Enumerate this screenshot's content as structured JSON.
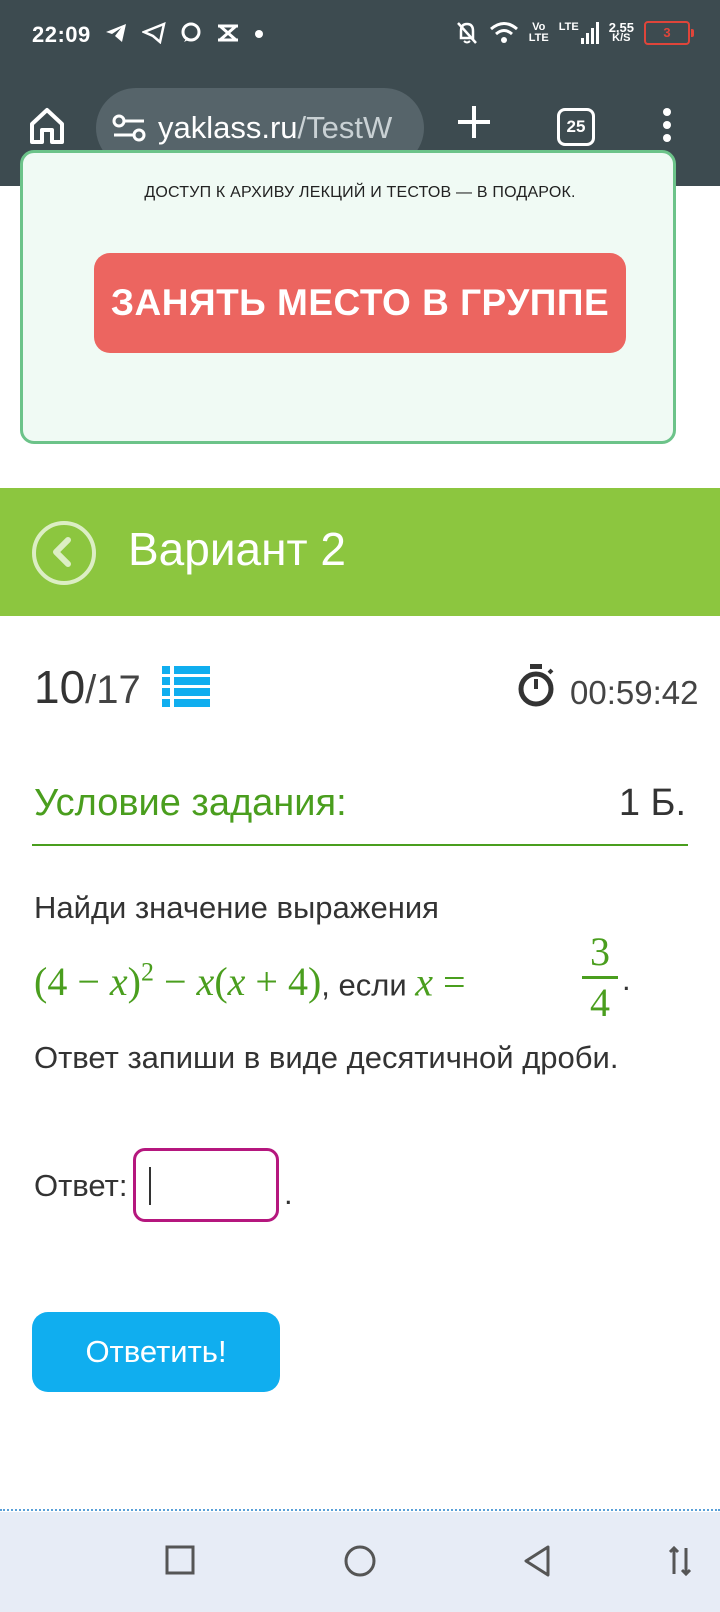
{
  "status_bar": {
    "time": "22:09",
    "volte": [
      "Vo",
      "LTE"
    ],
    "lte": "LTE",
    "speed": [
      "2,55",
      "K/S"
    ],
    "battery": "3",
    "battery_color": "#e0453a"
  },
  "browser": {
    "url_host": "yaklass.ru",
    "url_path": "/TestW",
    "tab_count": "25"
  },
  "promo": {
    "text": "ДОСТУП К АРХИВУ ЛЕКЦИЙ И ТЕСТОВ — В ПОДАРОК.",
    "button_label": "ЗАНЯТЬ МЕСТО В ГРУППЕ",
    "button_color": "#ec6560"
  },
  "variant": {
    "title": "Вариант 2",
    "header_color": "#8cc63f"
  },
  "progress": {
    "current": "10",
    "total": "/17",
    "timer": "00:59:42"
  },
  "task": {
    "heading": "Условие задания:",
    "score": "1 Б.",
    "line1": "Найди значение выражения",
    "math_expr_parts": [
      "(4 − ",
      "x",
      ")",
      "2",
      " − ",
      "x",
      "(",
      "x",
      " + 4)"
    ],
    "middle_text": ", если ",
    "var_x": "x",
    "equals": " = ",
    "fraction_num": "3",
    "fraction_den": "4",
    "end_dot": ".",
    "line3": "Ответ запиши в виде десятичной дроби.",
    "accent_color": "#4a9e1e"
  },
  "answer": {
    "label": "Ответ:",
    "value": "",
    "dot": ".",
    "submit_label": "Ответить!",
    "submit_color": "#10aeef"
  },
  "nav": {
    "icons": [
      "square-icon",
      "circle-icon",
      "triangle-back-icon",
      "rotate-icon"
    ]
  }
}
